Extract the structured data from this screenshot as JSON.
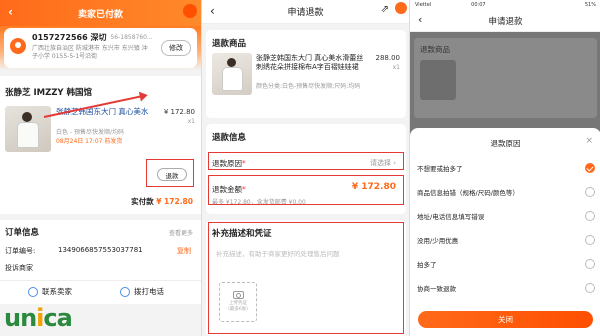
{
  "panel1": {
    "title": "卖家已付款",
    "address": {
      "name": "0157272566 深切",
      "phone": "56-1858760...",
      "text": "广西壮族自治区 防城港市 东兴市 东兴镇 沖子小学 0155-5-1号沿街",
      "edit": "修改"
    },
    "shop": "张静芝 IMZZY 韩国馆",
    "product": {
      "title": "张静芝韩国东大门 真心美水",
      "price": "¥ 172.80",
      "qty": "x1",
      "spec": "白色 - 预售尽快发顺/均码",
      "date": "08月24日 17:07 前发货"
    },
    "refund_btn": "退款",
    "paid_label": "实付款",
    "paid_amount": "¥ 172.80",
    "order": {
      "title": "订单信息",
      "collapse": "查看更多",
      "number_label": "订单编号:",
      "number": "1349066857553037781",
      "copy": "复制",
      "merchant_label": "投诉商家"
    },
    "contact_seller": "联系卖家",
    "call": "拨打电话",
    "logo_a": "un",
    "logo_b": "i",
    "logo_c": "ca"
  },
  "panel2": {
    "title": "申请退款",
    "goods_title": "退款商品",
    "product": {
      "title": "张静芝韩国东大门 真心美水滑蕾丝刺绣花朵拼接棉布A字百褶娃娃裙",
      "price": "288.00",
      "qty": "x1",
      "spec": "颜色分类:白色-预售尽快发顺;尺码:均码"
    },
    "info_title": "退款信息",
    "reason_label": "退款原因",
    "reason_star": "*",
    "reason_choose": "请选择",
    "amount_label": "退款金额",
    "amount_star": "*",
    "amount": "¥ 172.80",
    "amount_max": "最多 ¥172.80，含发货邮费 ¥0.00",
    "desc_title": "补充描述和凭证",
    "desc_placeholder": "补充描述，有助于商家更好的处理售后问题",
    "upload_label": "上传凭证",
    "upload_sub": "(最多6张)"
  },
  "panel3": {
    "carrier": "Viettel",
    "time": "00:07",
    "battery": "51%",
    "title": "申请退款",
    "bg_label": "退款商品",
    "sheet_title": "退款原因",
    "options": [
      {
        "label": "不想要或拍多了",
        "selected": true
      },
      {
        "label": "商品信息拍错（规格/尺码/颜色等）",
        "selected": false
      },
      {
        "label": "地址/电话信息填写错误",
        "selected": false
      },
      {
        "label": "没用/少用优惠",
        "selected": false
      },
      {
        "label": "拍多了",
        "selected": false
      },
      {
        "label": "协商一致退款",
        "selected": false
      }
    ],
    "close": "关闭"
  }
}
